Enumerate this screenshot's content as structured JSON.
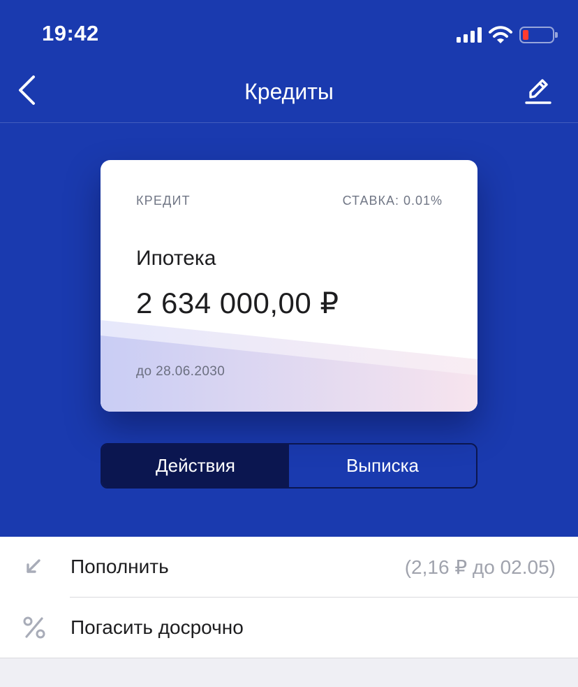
{
  "status_bar": {
    "time": "19:42",
    "signal_icon": "cellular-signal-icon",
    "wifi_icon": "wifi-icon",
    "battery_icon": "battery-low-icon",
    "battery_color": "#ff3b30"
  },
  "nav": {
    "title": "Кредиты",
    "back_icon": "chevron-left-icon",
    "edit_icon": "pencil-icon"
  },
  "card": {
    "type_label": "КРЕДИТ",
    "rate_label": "СТАВКА: 0.01%",
    "product_name": "Ипотека",
    "amount": "2 634 000,00 ₽",
    "due_date": "до 28.06.2030"
  },
  "segments": [
    {
      "label": "Действия",
      "selected": true
    },
    {
      "label": "Выписка",
      "selected": false
    }
  ],
  "actions": [
    {
      "label": "Пополнить",
      "hint": "(2,16 ₽ до 02.05)",
      "icon": "arrow-down-left-icon"
    },
    {
      "label": "Погасить досрочно",
      "hint": "",
      "icon": "percent-icon"
    }
  ],
  "colors": {
    "header_bg": "#1a3aaf",
    "segment_active": "#0b1650",
    "page_bg": "#efeff4"
  }
}
